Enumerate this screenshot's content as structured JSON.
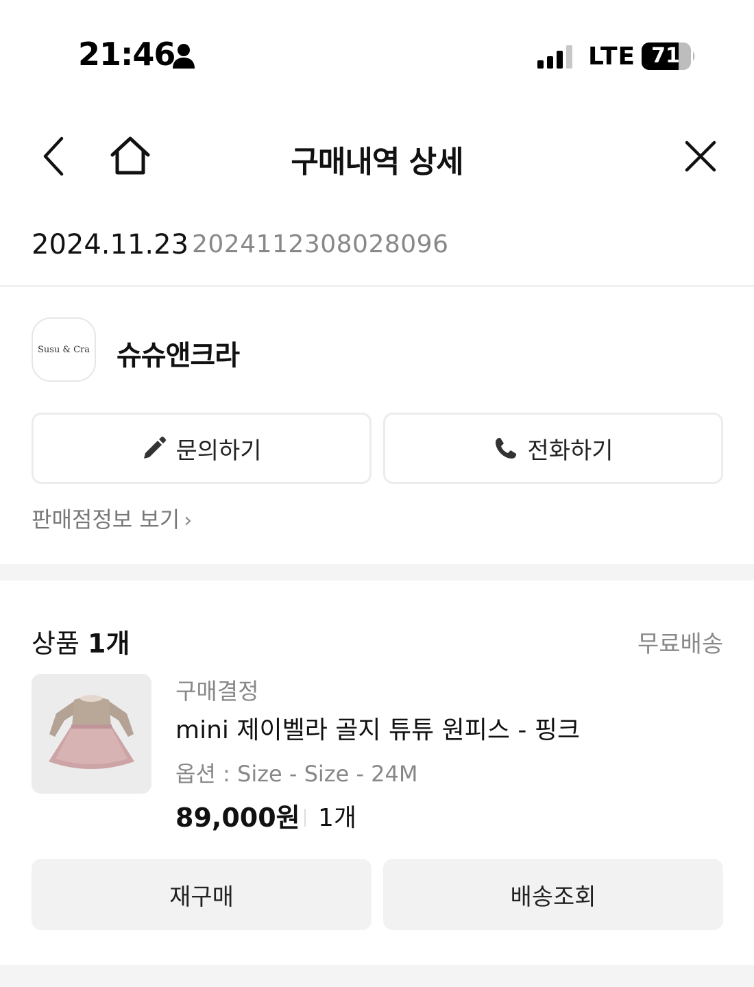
{
  "status_bar": {
    "time": "21:46",
    "network": "LTE",
    "battery": "71"
  },
  "nav": {
    "title": "구매내역 상세"
  },
  "order": {
    "date": "2024.11.23",
    "number": "2024112308028096"
  },
  "store": {
    "logo_text": "Susu & Cra",
    "name": "슈슈앤크라",
    "inquiry_label": "문의하기",
    "call_label": "전화하기",
    "info_link": "판매점정보 보기"
  },
  "products": {
    "heading_label": "상품",
    "heading_count": "1개",
    "shipping": "무료배송",
    "item": {
      "status": "구매결정",
      "name": "mini 제이벨라 골지 튜튜 원피스 - 핑크",
      "option": "옵션 : Size - Size - 24M",
      "price": "89,000원",
      "quantity": "1개"
    },
    "rebuy_label": "재구매",
    "tracking_label": "배송조회"
  },
  "icons": {
    "person": "person-icon",
    "signal": "signal-icon",
    "battery": "battery-icon",
    "back": "chevron-left-icon",
    "home": "home-icon",
    "close": "close-icon",
    "pencil": "pencil-icon",
    "phone": "phone-icon",
    "chevron": "chevron-right-icon"
  }
}
